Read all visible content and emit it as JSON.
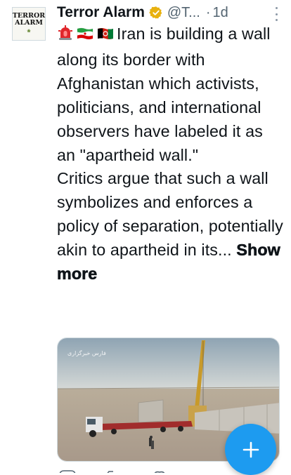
{
  "author": {
    "avatar_text_line1": "TERROR",
    "avatar_text_line2": "ALARM",
    "name": "Terror Alarm",
    "handle": "@T...",
    "separator": "·",
    "time": "1d"
  },
  "tweet": {
    "emojis": [
      "rotating-light",
      "flag-iran",
      "flag-afghanistan"
    ],
    "paragraph1": "Iran is building a wall along its border with Afghanistan which activists, politicians, and international observers have labeled it as an \"apartheid wall.\"",
    "paragraph2": "Critics argue that such a wall symbolizes and enforces a policy of separation, potentially akin to apartheid in its...",
    "show_more": "Show more"
  },
  "media": {
    "watermark": "فارس  خبرگزاری"
  },
  "colors": {
    "accent": "#1d9bf0",
    "text": "#0f1419",
    "secondary": "#536471",
    "verified": "#e8b10f"
  },
  "fab": {
    "icon": "plus-icon"
  }
}
